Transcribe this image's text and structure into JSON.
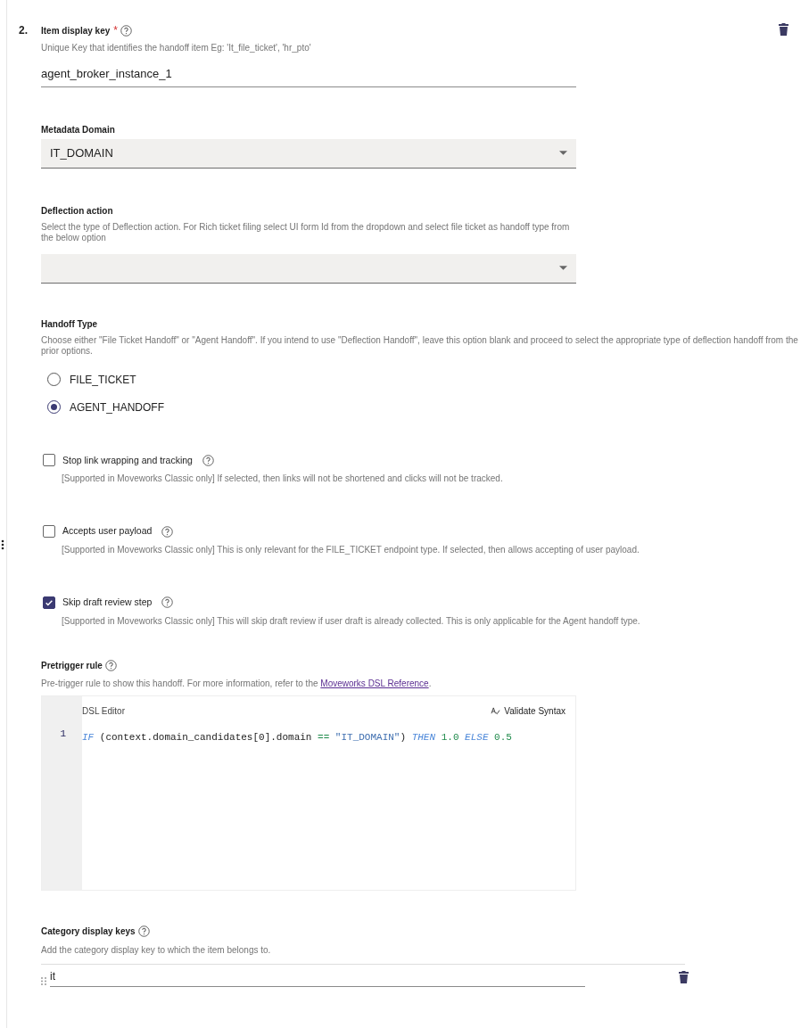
{
  "item_number": "2.",
  "item_key": {
    "label": "Item display key",
    "required_mark": "*",
    "hint": "Unique Key that identifies the handoff item Eg: 'It_file_ticket', 'hr_pto'",
    "value": "agent_broker_instance_1"
  },
  "metadata_domain": {
    "label": "Metadata Domain",
    "value": "IT_DOMAIN"
  },
  "deflection_action": {
    "label": "Deflection action",
    "hint": "Select the type of Deflection action. For Rich ticket filing select UI form Id from the dropdown and select file ticket as handoff type from the below option"
  },
  "handoff_type": {
    "label": "Handoff Type",
    "hint": "Choose either \"File Ticket Handoff\" or \"Agent Handoff\". If you intend to use \"Deflection Handoff\", leave this option blank and proceed to select the appropriate type of deflection handoff from the prior options.",
    "options": [
      {
        "label": "FILE_TICKET",
        "selected": false
      },
      {
        "label": "AGENT_HANDOFF",
        "selected": true
      }
    ]
  },
  "checkboxes": [
    {
      "label": "Stop link wrapping and tracking",
      "checked": false,
      "hint": "[Supported in Moveworks Classic only] If selected, then links will not be shortened and clicks will not be tracked."
    },
    {
      "label": "Accepts user payload",
      "checked": false,
      "hint": "[Supported in Moveworks Classic only] This is only relevant for the FILE_TICKET endpoint type. If selected, then allows accepting of user payload."
    },
    {
      "label": "Skip draft review step",
      "checked": true,
      "hint": "[Supported in Moveworks Classic only] This will skip draft review if user draft is already collected. This is only applicable for the Agent handoff type."
    }
  ],
  "pretrigger": {
    "label": "Pretrigger rule",
    "hint": "Pre-trigger rule to show this handoff. For more information, refer to the",
    "link": "Moveworks DSL Reference",
    "hint_end": ".",
    "editor": {
      "title": "DSL Editor",
      "validate": "Validate Syntax",
      "lines": [
        {
          "number": "1",
          "tokens": [
            {
              "text": "IF",
              "kind": "keyword"
            },
            {
              "text": " (context.domain_candidates[0].domain ",
              "kind": "plain"
            },
            {
              "text": "==",
              "kind": "operator"
            },
            {
              "text": " \"IT_DOMAIN\"",
              "kind": "string"
            },
            {
              "text": ") ",
              "kind": "plain"
            },
            {
              "text": "THEN",
              "kind": "keyword"
            },
            {
              "text": " 1.0 ",
              "kind": "number"
            },
            {
              "text": "ELSE",
              "kind": "keyword"
            },
            {
              "text": " 0.5",
              "kind": "number"
            }
          ]
        }
      ]
    }
  },
  "category": {
    "label": "Category display keys",
    "hint": "Add the category display key to which the item belongs to.",
    "keys": [
      {
        "value": "it"
      }
    ]
  }
}
